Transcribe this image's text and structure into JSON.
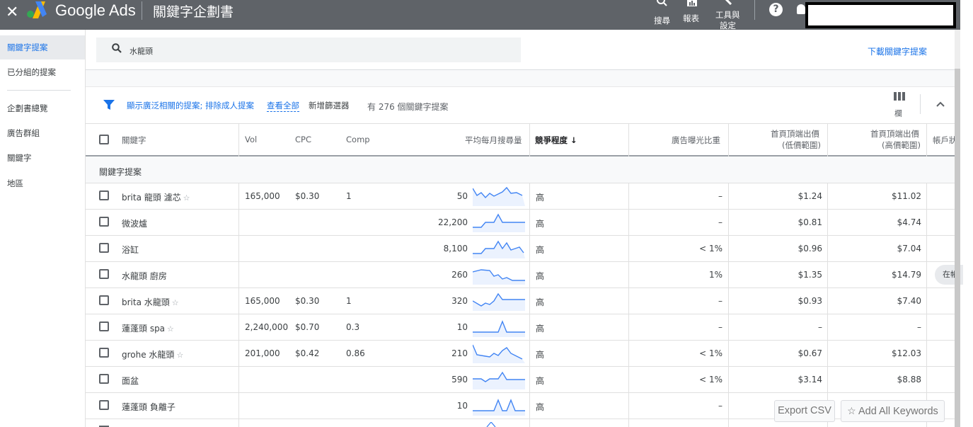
{
  "header": {
    "close_icon": "close-icon",
    "brand": "Google Ads",
    "title": "關鍵字企劃書",
    "search_label": "搜尋",
    "reports_label": "報表",
    "tools_label_1": "工具與",
    "tools_label_2": "設定"
  },
  "sidebar": {
    "items": [
      {
        "label": "關鍵字提案"
      },
      {
        "label": "已分組的提案"
      },
      {
        "label": "企劃書總覽"
      },
      {
        "label": "廣告群組"
      },
      {
        "label": "關鍵字"
      },
      {
        "label": "地區"
      }
    ]
  },
  "search": {
    "value": "水龍頭"
  },
  "download_label": "下載關鍵字提案",
  "filters": {
    "text": "顯示廣泛相關的提案; 排除成人提案",
    "view_all": "查看全部",
    "add_filter": "新增篩選器",
    "count": "有 276 個關鍵字提案",
    "columns_label": "欄"
  },
  "table": {
    "headers": {
      "keyword": "關鍵字",
      "vol": "Vol",
      "cpc": "CPC",
      "comp": "Comp",
      "avg_monthly": "平均每月搜尋量",
      "competition": "競爭程度 ↓",
      "impression_share": "廣告曝光比重",
      "bid_low_1": "首頁頂端出價",
      "bid_low_2": "(低價範圍)",
      "bid_high_1": "首頁頂端出價",
      "bid_high_2": "(高價範圍)",
      "account_status": "帳戶狀"
    },
    "group_label": "關鍵字提案",
    "rows": [
      {
        "keyword": "brita 龍頭 濾芯",
        "star": true,
        "vol": "165,000",
        "cpc": "$0.30",
        "comp": "1",
        "avg": "50",
        "competition": "高",
        "share": "–",
        "low": "$1.24",
        "high": "$11.02"
      },
      {
        "keyword": "微波爐",
        "star": false,
        "vol": "",
        "cpc": "",
        "comp": "",
        "avg": "22,200",
        "competition": "高",
        "share": "–",
        "low": "$0.81",
        "high": "$4.74"
      },
      {
        "keyword": "浴缸",
        "star": false,
        "vol": "",
        "cpc": "",
        "comp": "",
        "avg": "8,100",
        "competition": "高",
        "share": "< 1%",
        "low": "$0.96",
        "high": "$7.04"
      },
      {
        "keyword": "水龍頭 廚房",
        "star": false,
        "vol": "",
        "cpc": "",
        "comp": "",
        "avg": "260",
        "competition": "高",
        "share": "1%",
        "low": "$1.35",
        "high": "$14.79"
      },
      {
        "keyword": "brita 水龍頭",
        "star": true,
        "vol": "165,000",
        "cpc": "$0.30",
        "comp": "1",
        "avg": "320",
        "competition": "高",
        "share": "–",
        "low": "$0.93",
        "high": "$7.40"
      },
      {
        "keyword": "蓮蓬頭 spa",
        "star": true,
        "vol": "2,240,000",
        "cpc": "$0.70",
        "comp": "0.3",
        "avg": "10",
        "competition": "高",
        "share": "–",
        "low": "–",
        "high": "–"
      },
      {
        "keyword": "grohe 水龍頭",
        "star": true,
        "vol": "201,000",
        "cpc": "$0.42",
        "comp": "0.86",
        "avg": "210",
        "competition": "高",
        "share": "< 1%",
        "low": "$0.67",
        "high": "$12.03"
      },
      {
        "keyword": "面盆",
        "star": false,
        "vol": "",
        "cpc": "",
        "comp": "",
        "avg": "590",
        "competition": "高",
        "share": "< 1%",
        "low": "$3.14",
        "high": "$8.88"
      },
      {
        "keyword": "蓮蓬頭 負離子",
        "star": false,
        "vol": "",
        "cpc": "",
        "comp": "",
        "avg": "10",
        "competition": "高",
        "share": "–",
        "low": "",
        "high": ""
      }
    ]
  },
  "row_chip": "在帳",
  "buttons": {
    "export_csv": "Export CSV",
    "add_all": "Add All Keywords"
  }
}
